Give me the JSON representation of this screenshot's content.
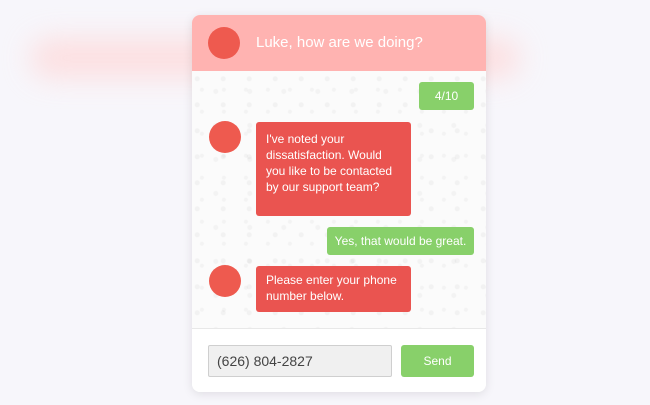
{
  "header": {
    "title": "Luke, how are we doing?",
    "avatar_color": "#ee5a4f",
    "background_color": "#ffb3b1"
  },
  "messages": [
    {
      "sender": "user",
      "text": "4/10"
    },
    {
      "sender": "bot",
      "text": "I've noted your dissatisfaction. Would you like to be contacted by our support team?"
    },
    {
      "sender": "user",
      "text": "Yes, that would be great."
    },
    {
      "sender": "bot",
      "text": "Please enter your phone number below."
    }
  ],
  "composer": {
    "phone_value": "(626) 804-2827",
    "send_label": "Send"
  },
  "colors": {
    "bot_bubble": "#ea5450",
    "user_bubble": "#88d06a",
    "avatar": "#ee5a4f"
  }
}
